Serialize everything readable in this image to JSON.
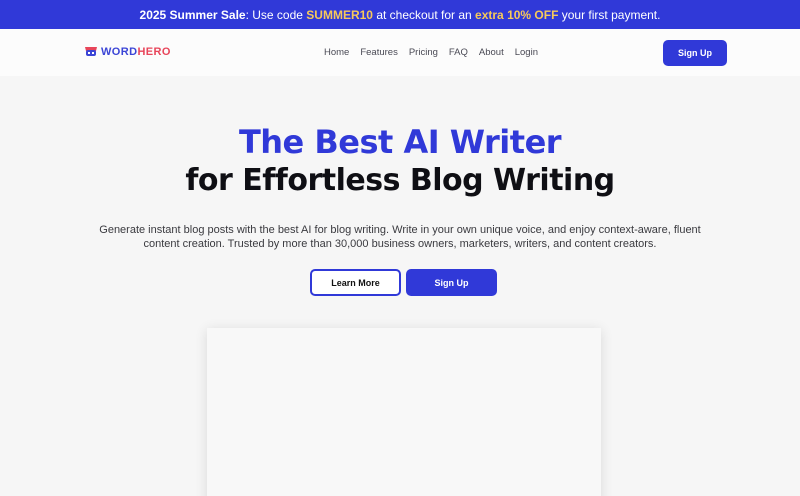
{
  "promo": {
    "sale_label": "2025 Summer Sale",
    "text1": ": Use code ",
    "code": "SUMMER10",
    "text2": " at checkout for an ",
    "discount": "extra 10% OFF",
    "text3": " your first payment."
  },
  "nav": {
    "logo_word": "WORD",
    "logo_hero": "HERO",
    "links": [
      "Home",
      "Features",
      "Pricing",
      "FAQ",
      "About",
      "Login"
    ],
    "signup_label": "Sign Up"
  },
  "hero": {
    "title_line1": "The Best AI Writer",
    "title_line2": "for Effortless Blog Writing",
    "description": "Generate instant blog posts with the best AI for blog writing. Write in your own unique voice, and enjoy context-aware, fluent content creation. Trusted by more than 30,000 business owners, marketers, writers, and content creators.",
    "learn_more_label": "Learn More",
    "signup_label": "Sign Up"
  },
  "colors": {
    "brand_blue": "#3039d8",
    "highlight_yellow": "#f7c95a",
    "logo_red": "#e8455a"
  }
}
